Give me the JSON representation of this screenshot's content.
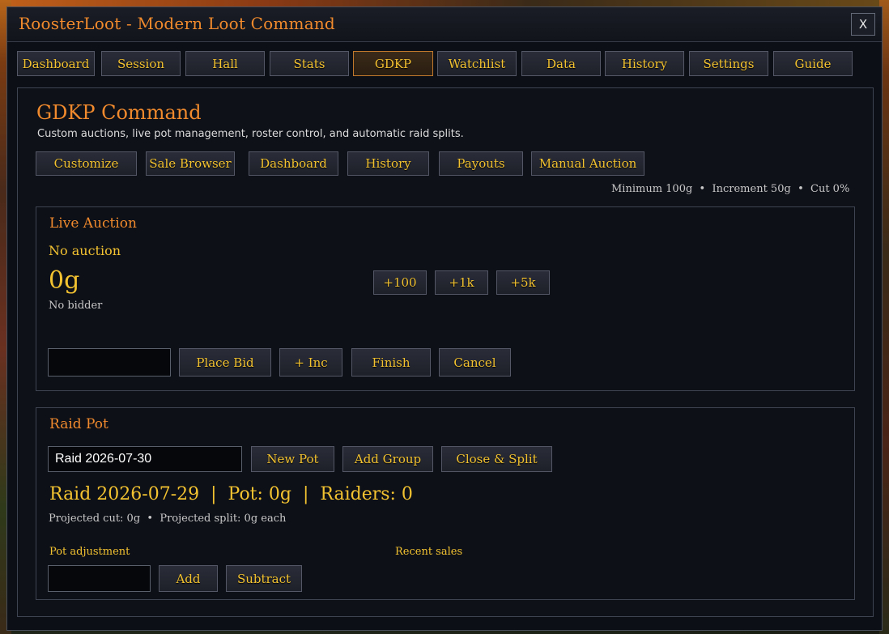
{
  "window": {
    "title": "RoosterLoot - Modern Loot Command",
    "close_label": "X"
  },
  "tabs": [
    {
      "label": "Dashboard"
    },
    {
      "label": "Session"
    },
    {
      "label": "Hall"
    },
    {
      "label": "Stats"
    },
    {
      "label": "GDKP",
      "active": true
    },
    {
      "label": "Watchlist"
    },
    {
      "label": "Data"
    },
    {
      "label": "History"
    },
    {
      "label": "Settings"
    },
    {
      "label": "Guide"
    }
  ],
  "gdkp": {
    "title": "GDKP Command",
    "subtitle": "Custom auctions, live pot management, roster control, and automatic raid splits.",
    "actions": [
      {
        "label": "Customize"
      },
      {
        "label": "Sale Browser"
      },
      {
        "label": "Dashboard"
      },
      {
        "label": "History"
      },
      {
        "label": "Payouts"
      },
      {
        "label": "Manual Auction"
      }
    ],
    "rules": "Minimum 100g  •  Increment 50g  •  Cut 0%"
  },
  "live_auction": {
    "title": "Live Auction",
    "item": "No auction",
    "current_bid": "0g",
    "bidder": "No bidder",
    "quick_bids": [
      {
        "label": "+100"
      },
      {
        "label": "+1k"
      },
      {
        "label": "+5k"
      }
    ],
    "bid_input": {
      "value": ""
    },
    "buttons": {
      "place_bid": "Place Bid",
      "increment": "+ Inc",
      "finish": "Finish",
      "cancel": "Cancel"
    }
  },
  "raid_pot": {
    "title": "Raid Pot",
    "pot_name_input": {
      "value": "Raid 2026-07-30"
    },
    "buttons": {
      "new_pot": "New Pot",
      "add_group": "Add Group",
      "close_split": "Close & Split"
    },
    "summary": "Raid 2026-07-29  |  Pot: 0g  |  Raiders: 0",
    "projection": "Projected cut: 0g  •  Projected split: 0g each",
    "adjustment_label": "Pot adjustment",
    "adjustment_input": {
      "value": ""
    },
    "adjust_buttons": {
      "add": "Add",
      "subtract": "Subtract"
    },
    "recent_sales_label": "Recent sales"
  },
  "colors": {
    "accent_orange": "#f08a2c",
    "gold_text": "#f2c230",
    "panel_bg": "#0e1018"
  }
}
